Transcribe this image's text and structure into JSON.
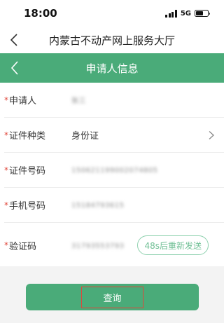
{
  "status_bar": {
    "time": "18:00",
    "network": "5G"
  },
  "app_header": {
    "title": "内蒙古不动产网上服务大厅"
  },
  "section_header": {
    "title": "申请人信息"
  },
  "form": {
    "fields": [
      {
        "label": "申请人",
        "value": "张三",
        "required_mark": "*"
      },
      {
        "label": "证件种类",
        "value": "身份证",
        "required_mark": "*"
      },
      {
        "label": "证件号码",
        "value": "150621199002074805",
        "required_mark": "*"
      },
      {
        "label": "手机号码",
        "value": "15184793615",
        "required_mark": "*"
      },
      {
        "label": "验证码",
        "value": "31793553793",
        "required_mark": "*"
      }
    ],
    "resend_button": "48s后重新发送"
  },
  "query_button": {
    "label": "查询"
  },
  "colors": {
    "accent": "#4aab79",
    "required": "#e0463a",
    "highlight": "#e0463a"
  }
}
